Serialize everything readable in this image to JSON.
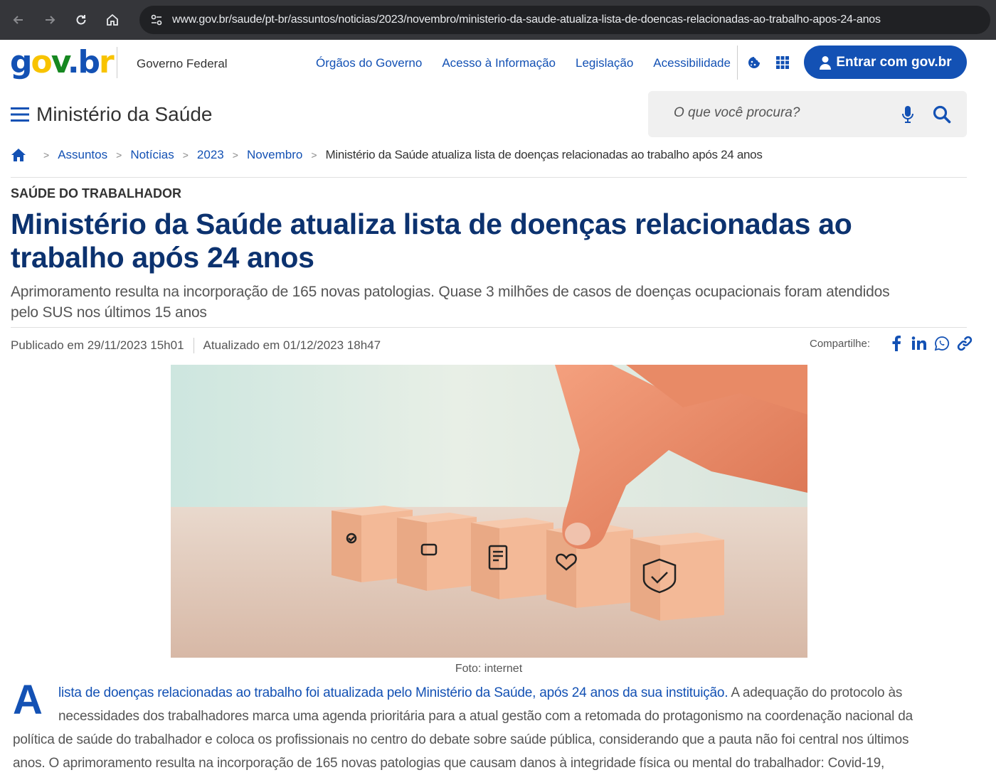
{
  "browser": {
    "url": "www.gov.br/saude/pt-br/assuntos/noticias/2023/novembro/ministerio-da-saude-atualiza-lista-de-doencas-relacionadas-ao-trabalho-apos-24-anos"
  },
  "header": {
    "logo": {
      "g": "g",
      "o": "o",
      "v": "v",
      "dot": ".",
      "b": "b",
      "r": "r"
    },
    "government_label": "Governo Federal",
    "links": [
      "Órgãos do Governo",
      "Acesso à Informação",
      "Legislação",
      "Acessibilidade"
    ],
    "login_label": "Entrar com gov.br",
    "brand_color": "#1351b4"
  },
  "ministry": {
    "title": "Ministério da Saúde",
    "search_placeholder": "O que você procura?"
  },
  "breadcrumb": {
    "items": [
      "Assuntos",
      "Notícias",
      "2023",
      "Novembro"
    ],
    "current": "Ministério da Saúde atualiza lista de doenças relacionadas ao trabalho após 24 anos"
  },
  "article": {
    "category": "SAÚDE DO TRABALHADOR",
    "headline_line1": "Ministério da Saúde atualiza lista de doenças relacionadas ao",
    "headline_line2": "trabalho após 24 anos",
    "subtitle_line1": "Aprimoramento resulta na incorporação de 165 novas patologias. Quase 3 milhões de casos de doenças ocupacionais foram atendidos",
    "subtitle_line2": "pelo SUS nos últimos 15 anos",
    "published": "Publicado em 29/11/2023 15h01",
    "updated": "Atualizado em 01/12/2023 18h47",
    "share_label": "Compartilhe:",
    "photo_caption": "Foto: internet",
    "dropcap": "A",
    "body_link": "lista de doenças relacionadas ao trabalho foi atualizada pelo Ministério da Saúde, após 24 anos da sua instituição.",
    "body_line1_rest": " A adequação do protocolo às",
    "body_line2": "necessidades dos trabalhadores marca uma agenda prioritária para a atual gestão com a retomada do protagonismo na coordenação nacional da",
    "body_line3": "política de saúde do trabalhador e coloca os profissionais no centro do debate sobre saúde pública, considerando que a pauta não foi central nos últimos",
    "body_line4": "anos. O aprimoramento resulta na incorporação de 165 novas patologias que causam danos à integridade física ou mental do trabalhador: Covid-19,"
  }
}
